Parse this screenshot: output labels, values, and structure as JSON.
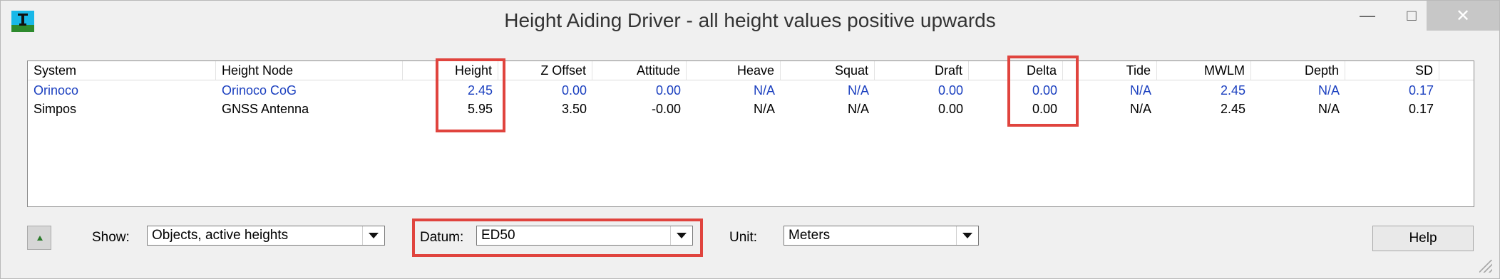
{
  "window": {
    "title": "Height Aiding Driver - all height values positive upwards",
    "min_label": "—",
    "max_label": "□",
    "close_label": "✕"
  },
  "table": {
    "columns": [
      "System",
      "Height Node",
      "Height",
      "Z Offset",
      "Attitude",
      "Heave",
      "Squat",
      "Draft",
      "Delta",
      "Tide",
      "MWLM",
      "Depth",
      "SD"
    ],
    "rows": [
      {
        "highlighted_color": "#1a3fbf",
        "cells": [
          "Orinoco",
          "Orinoco CoG",
          "2.45",
          "0.00",
          "0.00",
          "N/A",
          "N/A",
          "0.00",
          "0.00",
          "N/A",
          "2.45",
          "N/A",
          "0.17"
        ]
      },
      {
        "cells": [
          "Simpos",
          "GNSS Antenna",
          "5.95",
          "3.50",
          "-0.00",
          "N/A",
          "N/A",
          "0.00",
          "0.00",
          "N/A",
          "2.45",
          "N/A",
          "0.17"
        ]
      }
    ]
  },
  "controls": {
    "show_label": "Show:",
    "show_value": "Objects, active heights",
    "datum_label": "Datum:",
    "datum_value": "ED50",
    "unit_label": "Unit:",
    "unit_value": "Meters",
    "help_label": "Help"
  },
  "colors": {
    "highlight_box": "#e0443e",
    "active_row_text": "#1a3fbf"
  }
}
